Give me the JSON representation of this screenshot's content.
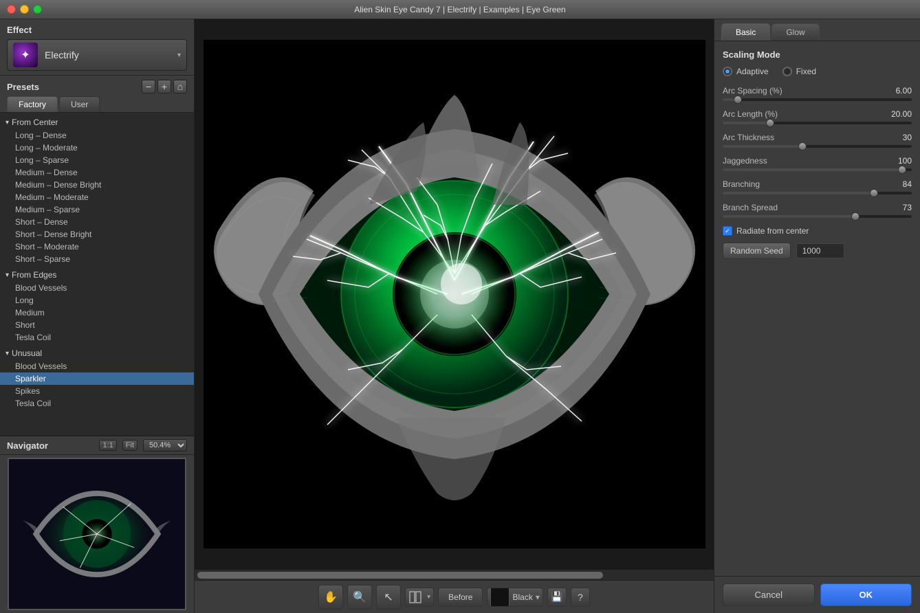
{
  "window": {
    "title": "Alien Skin Eye Candy 7 | Electrify | Examples | Eye Green"
  },
  "left_panel": {
    "effect_label": "Effect",
    "effect_name": "Electrify",
    "presets_label": "Presets",
    "tabs": [
      {
        "id": "factory",
        "label": "Factory"
      },
      {
        "id": "user",
        "label": "User"
      }
    ],
    "groups": [
      {
        "name": "From Center",
        "items": [
          "Long – Dense",
          "Long – Moderate",
          "Long – Sparse",
          "Medium – Dense",
          "Medium – Dense Bright",
          "Medium – Moderate",
          "Medium – Sparse",
          "Short – Dense",
          "Short – Dense Bright",
          "Short – Moderate",
          "Short – Sparse"
        ]
      },
      {
        "name": "From Edges",
        "items": [
          "Blood Vessels",
          "Long",
          "Medium",
          "Short",
          "Tesla Coil"
        ]
      },
      {
        "name": "Unusual",
        "items": [
          "Blood Vessels",
          "Sparkler",
          "Spikes",
          "Tesla Coil"
        ]
      }
    ],
    "selected_item": "Sparkler"
  },
  "navigator": {
    "label": "Navigator",
    "zoom_1to1": "1:1",
    "zoom_fit": "Fit",
    "zoom_percent": "50.4%"
  },
  "right_panel": {
    "tabs": [
      "Basic",
      "Glow"
    ],
    "active_tab": "Basic",
    "scaling_mode_label": "Scaling Mode",
    "adaptive_label": "Adaptive",
    "fixed_label": "Fixed",
    "params": [
      {
        "id": "arc_spacing",
        "label": "Arc Spacing (%)",
        "value": "6.00",
        "percent": 8
      },
      {
        "id": "arc_length",
        "label": "Arc Length (%)",
        "value": "20.00",
        "percent": 25
      },
      {
        "id": "arc_thickness",
        "label": "Arc Thickness",
        "value": "30",
        "percent": 42
      },
      {
        "id": "jaggedness",
        "label": "Jaggedness",
        "value": "100",
        "percent": 95
      },
      {
        "id": "branching",
        "label": "Branching",
        "value": "84",
        "percent": 80
      },
      {
        "id": "branch_spread",
        "label": "Branch Spread",
        "value": "73",
        "percent": 70
      }
    ],
    "radiate_label": "Radiate from center",
    "radiate_checked": true,
    "random_seed_btn": "Random Seed",
    "seed_value": "1000"
  },
  "bottom_toolbar": {
    "before_label": "Before",
    "bg_color_label": "Black",
    "tools": [
      "hand",
      "zoom",
      "arrow"
    ],
    "cancel_label": "Cancel",
    "ok_label": "OK"
  }
}
